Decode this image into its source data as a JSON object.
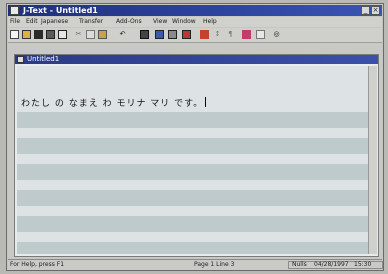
{
  "window": {
    "title": "J-Text - Untitled1"
  },
  "menu": [
    "File",
    "Edit",
    "Japanese",
    "Transfer",
    "Add-Ons",
    "View",
    "Window",
    "Help"
  ],
  "document": {
    "title": "Untitled1",
    "text": "わたし の なまえ わ モリナ マリ です。"
  },
  "status": {
    "help": "For Help, press F1",
    "page": "Page 1 Line 3",
    "mode": "Nulls",
    "date": "04/28/1997",
    "time": "15:30"
  },
  "icons": {
    "new": "new-file-icon",
    "open": "open-folder-icon",
    "save": "save-icon",
    "print": "print-icon",
    "print_preview": "print-preview-icon",
    "cut": "cut-icon",
    "copy": "copy-icon",
    "paste": "paste-icon",
    "dictionary": "dictionary-icon",
    "convert": "convert-icon",
    "kana": "kana-icon",
    "settings": "settings-icon"
  }
}
